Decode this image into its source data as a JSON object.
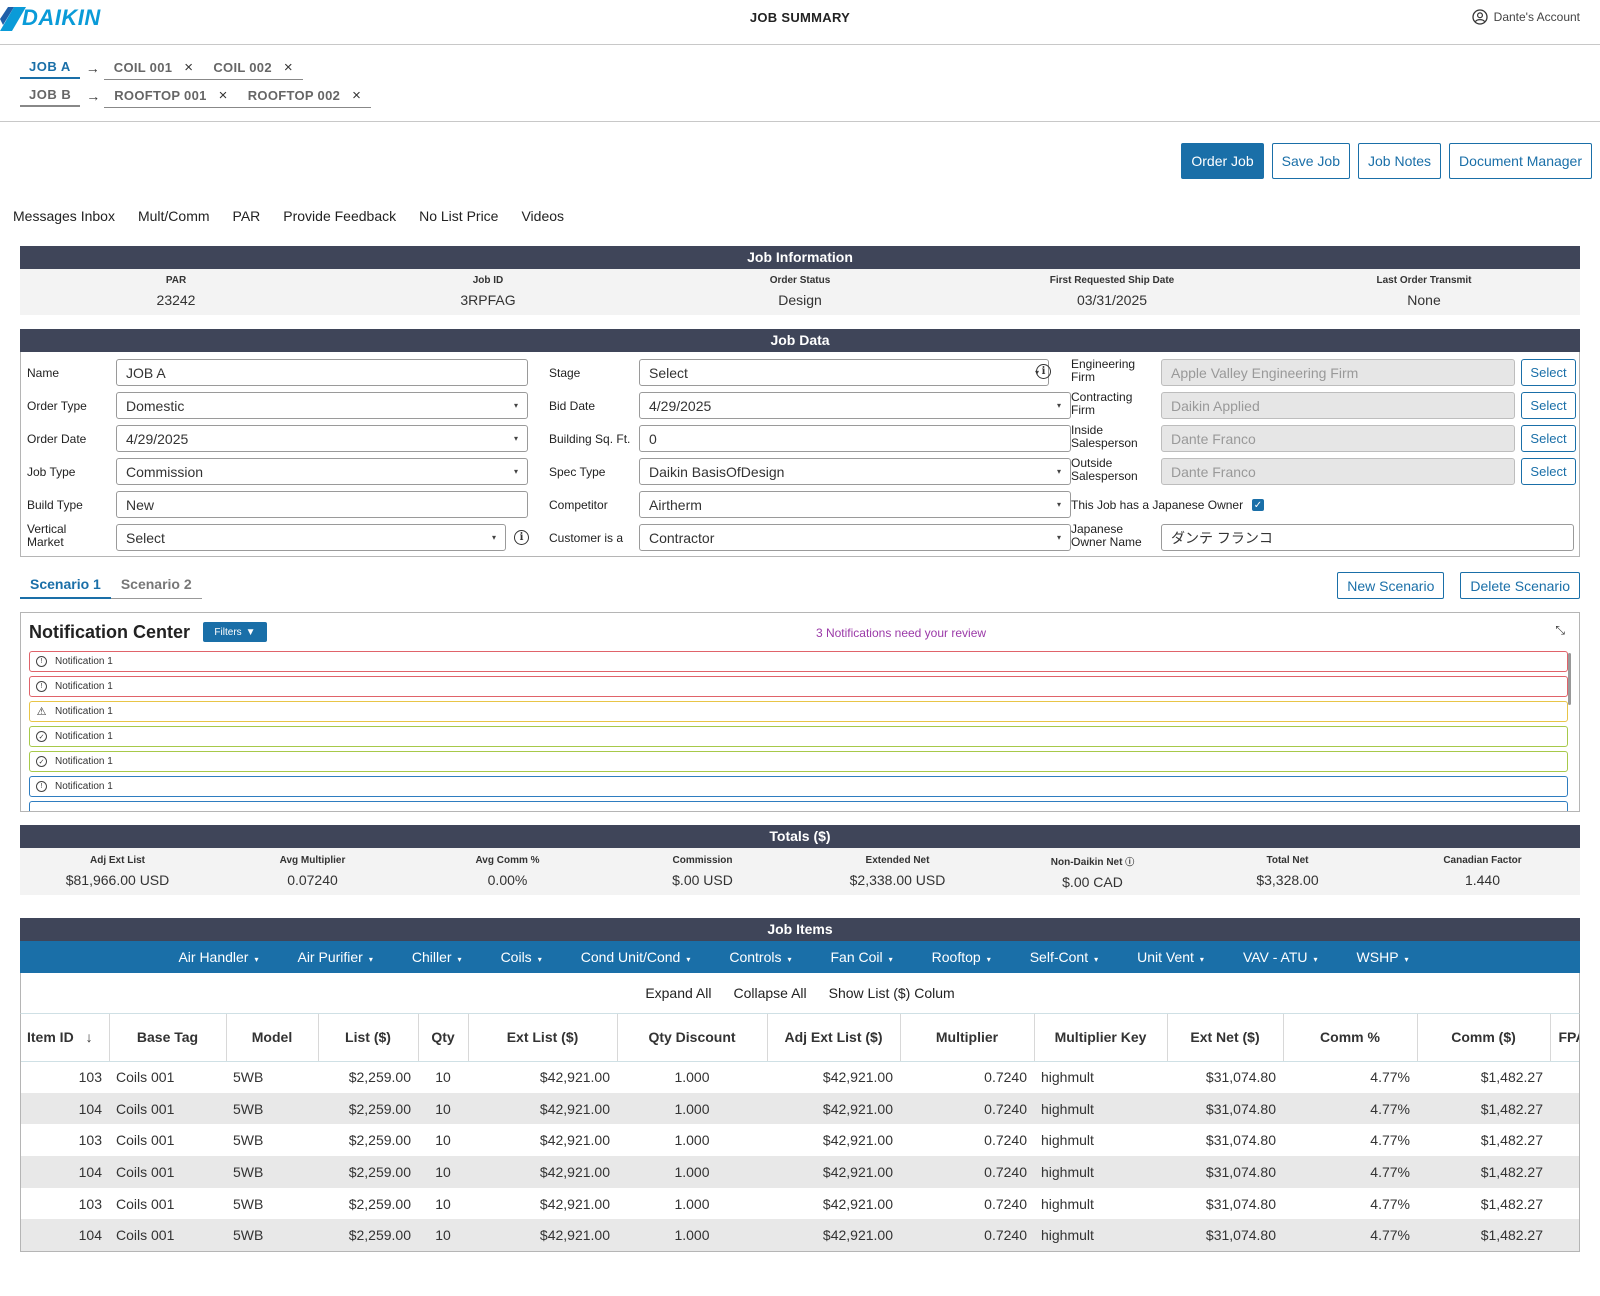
{
  "header": {
    "brand": "DAIKIN",
    "title": "JOB SUMMARY",
    "account": "Dante's Account"
  },
  "jobnav": {
    "rows": [
      {
        "job": "JOB  A",
        "active": true,
        "items": [
          "COIL 001",
          "COIL 002"
        ]
      },
      {
        "job": "JOB  B",
        "active": false,
        "items": [
          "ROOFTOP 001",
          "ROOFTOP 002"
        ]
      }
    ]
  },
  "actions": {
    "order": "Order Job",
    "save": "Save Job",
    "notes": "Job Notes",
    "docs": "Document Manager"
  },
  "links": [
    "Messages Inbox",
    "Mult/Comm",
    "PAR",
    "Provide Feedback",
    "No List Price",
    "Videos"
  ],
  "job_info": {
    "title": "Job Information",
    "fields": [
      {
        "label": "PAR",
        "value": "23242"
      },
      {
        "label": "Job ID",
        "value": "3RPFAG"
      },
      {
        "label": "Order Status",
        "value": "Design"
      },
      {
        "label": "First Requested Ship Date",
        "value": "03/31/2025"
      },
      {
        "label": "Last Order Transmit",
        "value": "None"
      }
    ]
  },
  "job_data": {
    "title": "Job Data",
    "name_label": "Name",
    "name_value": "JOB A",
    "order_type_label": "Order Type",
    "order_type_value": "Domestic",
    "order_date_label": "Order Date",
    "order_date_value": "4/29/2025",
    "job_type_label": "Job Type",
    "job_type_value": "Commission",
    "build_type_label": "Build Type",
    "build_type_value": "New",
    "vertical_market_label_1": "Vertical",
    "vertical_market_label_2": "Market",
    "vertical_market_value": "Select",
    "stage_label": "Stage",
    "stage_value": "Select",
    "bid_date_label": "Bid Date",
    "bid_date_value": "4/29/2025",
    "sqft_label": "Building Sq. Ft.",
    "sqft_value": "0",
    "spec_type_label": "Spec Type",
    "spec_type_value": "Daikin BasisOfDesign",
    "competitor_label": "Competitor",
    "competitor_value": "Airtherm",
    "customer_label": "Customer is a",
    "customer_value": "Contractor",
    "eng_firm_label_1": "Engineering",
    "eng_firm_label_2": "Firm",
    "eng_firm_value": "Apple Valley Engineering Firm",
    "contract_firm_label_1": "Contracting",
    "contract_firm_label_2": "Firm",
    "contract_firm_value": "Daikin Applied",
    "inside_sales_label_1": "Inside",
    "inside_sales_label_2": "Salesperson",
    "inside_sales_value": "Dante Franco",
    "outside_sales_label_1": "Outside",
    "outside_sales_label_2": "Salesperson",
    "outside_sales_value": "Dante Franco",
    "japanese_owner_label": "This Job has a Japanese Owner",
    "japanese_name_label_1": "Japanese",
    "japanese_name_label_2": "Owner Name",
    "japanese_name_value": "ダンテ フランコ",
    "select_label": "Select"
  },
  "scenarios": {
    "tabs": [
      "Scenario 1",
      "Scenario 2"
    ],
    "new": "New Scenario",
    "delete": "Delete Scenario"
  },
  "notifications": {
    "title": "Notification Center",
    "filters": "Filters",
    "count_text": "3 Notifications need your review",
    "items": [
      {
        "text": "Notification 1",
        "level": "red",
        "icon": "clock-icon"
      },
      {
        "text": "Notification 1",
        "level": "red",
        "icon": "clock-icon"
      },
      {
        "text": "Notification 1",
        "level": "yellow",
        "icon": "warning-icon"
      },
      {
        "text": "Notification 1",
        "level": "green",
        "icon": "check-circle-icon"
      },
      {
        "text": "Notification 1",
        "level": "green",
        "icon": "check-circle-icon"
      },
      {
        "text": "Notification 1",
        "level": "blue",
        "icon": "clock-icon"
      }
    ]
  },
  "totals": {
    "title": "Totals ($)",
    "fields": [
      {
        "label": "Adj Ext List",
        "value": "$81,966.00 USD"
      },
      {
        "label": "Avg Multiplier",
        "value": "0.07240"
      },
      {
        "label": "Avg Comm %",
        "value": "0.00%"
      },
      {
        "label": "Commission",
        "value": "$.00 USD"
      },
      {
        "label": "Extended Net",
        "value": "$2,338.00 USD"
      },
      {
        "label": "Non-Daikin Net",
        "value": "$.00 CAD"
      },
      {
        "label": "Total Net",
        "value": "$3,328.00"
      },
      {
        "label": "Canadian Factor",
        "value": "1.440"
      }
    ]
  },
  "job_items": {
    "title": "Job Items",
    "categories": [
      "Air Handler",
      "Air Purifier",
      "Chiller",
      "Coils",
      "Cond Unit/Cond",
      "Controls",
      "Fan Coil",
      "Rooftop",
      "Self-Cont",
      "Unit Vent",
      "VAV - ATU",
      "WSHP"
    ],
    "expand": "Expand All",
    "collapse": "Collapse All",
    "show_list": "Show List ($) Colum",
    "columns": [
      "Item ID",
      "Base Tag",
      "Model",
      "List ($)",
      "Qty",
      "Ext List ($)",
      "Qty Discount",
      "Adj Ext List ($)",
      "Multiplier",
      "Multiplier Key",
      "Ext Net ($)",
      "Comm %",
      "Comm ($)",
      "FPA"
    ],
    "rows": [
      [
        "103",
        "Coils 001",
        "5WB",
        "$2,259.00",
        "10",
        "$42,921.00",
        "1.000",
        "$42,921.00",
        "0.7240",
        "highmult",
        "$31,074.80",
        "4.77%",
        "$1,482.27",
        ""
      ],
      [
        "104",
        "Coils 001",
        "5WB",
        "$2,259.00",
        "10",
        "$42,921.00",
        "1.000",
        "$42,921.00",
        "0.7240",
        "highmult",
        "$31,074.80",
        "4.77%",
        "$1,482.27",
        ""
      ],
      [
        "103",
        "Coils 001",
        "5WB",
        "$2,259.00",
        "10",
        "$42,921.00",
        "1.000",
        "$42,921.00",
        "0.7240",
        "highmult",
        "$31,074.80",
        "4.77%",
        "$1,482.27",
        ""
      ],
      [
        "104",
        "Coils 001",
        "5WB",
        "$2,259.00",
        "10",
        "$42,921.00",
        "1.000",
        "$42,921.00",
        "0.7240",
        "highmult",
        "$31,074.80",
        "4.77%",
        "$1,482.27",
        ""
      ],
      [
        "103",
        "Coils 001",
        "5WB",
        "$2,259.00",
        "10",
        "$42,921.00",
        "1.000",
        "$42,921.00",
        "0.7240",
        "highmult",
        "$31,074.80",
        "4.77%",
        "$1,482.27",
        ""
      ],
      [
        "104",
        "Coils 001",
        "5WB",
        "$2,259.00",
        "10",
        "$42,921.00",
        "1.000",
        "$42,921.00",
        "0.7240",
        "highmult",
        "$31,074.80",
        "4.77%",
        "$1,482.27",
        ""
      ]
    ]
  },
  "colors": {
    "brand": "#0a9bd8",
    "accent": "#1a6fa8",
    "bar": "#3f4559",
    "notice": "#9b3aa8"
  }
}
